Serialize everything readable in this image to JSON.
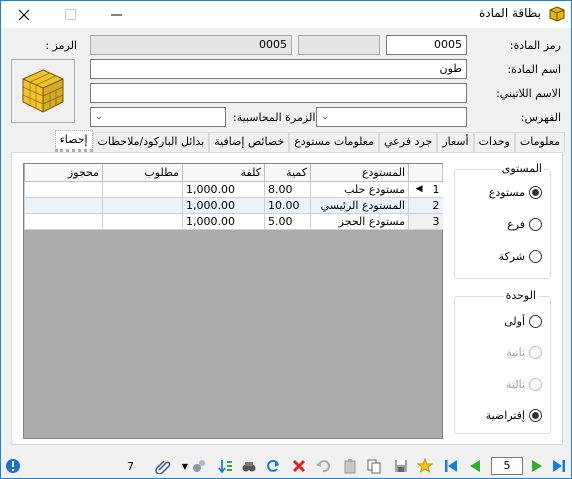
{
  "window": {
    "title": "بطاقة المادة",
    "minimize_icon": "minimize-icon",
    "maximize_icon": "maximize-icon",
    "close_icon": "close-icon"
  },
  "header": {
    "code_label": "رمز المادة:",
    "code_value": "0005",
    "symbol_label": "الرمز :",
    "symbol_value": "0005",
    "name_label": "اسم المادة:",
    "name_value": "طون",
    "latin_label": "الاسم اللاتيني:",
    "latin_value": "",
    "index_label": "الفهرس:",
    "accounting_label": "الزمرة المحاسبية:"
  },
  "tabs": [
    {
      "label": "معلومات"
    },
    {
      "label": "وحدات"
    },
    {
      "label": "أسعار"
    },
    {
      "label": "جرد فرعي"
    },
    {
      "label": "معلومات مستودع"
    },
    {
      "label": "خصائص إضافية"
    },
    {
      "label": "بدائل الباركود/ملاحظات"
    },
    {
      "label": "إحصاء"
    }
  ],
  "grid": {
    "columns": [
      "المستودع",
      "كمية",
      "كلفة",
      "مطلوب",
      "محجوز"
    ],
    "rows": [
      {
        "n": "1",
        "store": "مستودع حلب",
        "qty": "8.00",
        "cost": "1,000.00",
        "req": "",
        "res": ""
      },
      {
        "n": "2",
        "store": "المستودع الرئيسي",
        "qty": "10.00",
        "cost": "1,000.00",
        "req": "",
        "res": ""
      },
      {
        "n": "3",
        "store": "مستودع الحجز",
        "qty": "5.00",
        "cost": "1,000.00",
        "req": "",
        "res": ""
      }
    ]
  },
  "level_group": {
    "title": "المستوى",
    "options": [
      {
        "label": "مستودع",
        "checked": true,
        "enabled": true
      },
      {
        "label": "فرع",
        "checked": false,
        "enabled": true
      },
      {
        "label": "شركة",
        "checked": false,
        "enabled": true
      }
    ]
  },
  "unit_group": {
    "title": "الوحدة",
    "options": [
      {
        "label": "أولى",
        "checked": false,
        "enabled": true
      },
      {
        "label": "ثانية",
        "checked": false,
        "enabled": false
      },
      {
        "label": "ثالثة",
        "checked": false,
        "enabled": false
      },
      {
        "label": "إفتراضية",
        "checked": true,
        "enabled": true
      }
    ]
  },
  "bottombar": {
    "count": "7",
    "page": "5"
  },
  "colors": {
    "accent": "#1883d7",
    "grid_bg": "#ababab",
    "nav_green": "#2fae2f",
    "nav_blue": "#1b7bd8",
    "delete_red": "#e02020"
  }
}
